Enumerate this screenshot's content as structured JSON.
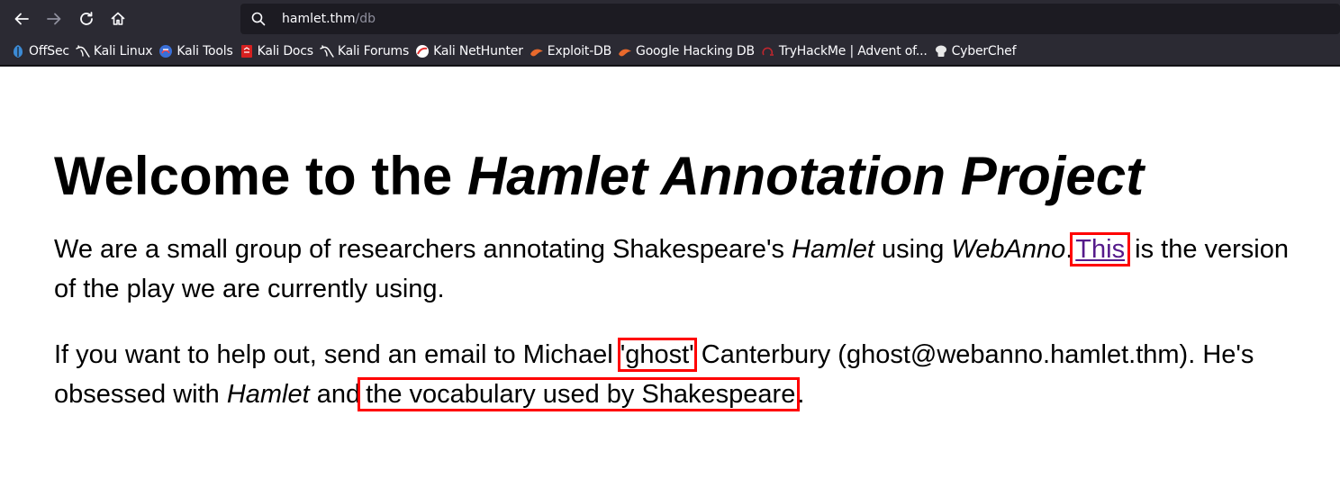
{
  "browser": {
    "url_host": "hamlet.thm",
    "url_path": "/db",
    "bookmarks": [
      {
        "label": "OffSec",
        "icon": "offsec-icon",
        "color": "#3c8bd6"
      },
      {
        "label": "Kali Linux",
        "icon": "kali-dragon-icon",
        "color": "#ffffff"
      },
      {
        "label": "Kali Tools",
        "icon": "kali-tools-icon",
        "color": "#3a6fd8"
      },
      {
        "label": "Kali Docs",
        "icon": "kali-docs-icon",
        "color": "#d62020"
      },
      {
        "label": "Kali Forums",
        "icon": "kali-dragon-icon",
        "color": "#ffffff"
      },
      {
        "label": "Kali NetHunter",
        "icon": "nethunter-icon",
        "color": "#e23030"
      },
      {
        "label": "Exploit-DB",
        "icon": "exploit-db-icon",
        "color": "#e8692c"
      },
      {
        "label": "Google Hacking DB",
        "icon": "ghdb-icon",
        "color": "#e8692c"
      },
      {
        "label": "TryHackMe | Advent of...",
        "icon": "tryhackme-icon",
        "color": "#c0262e"
      },
      {
        "label": "CyberChef",
        "icon": "cyberchef-icon",
        "color": "#e8e8e8"
      }
    ]
  },
  "page": {
    "title_plain": "Welcome to the ",
    "title_em": "Hamlet Annotation Project",
    "p1": {
      "t1": "We are a small group of researchers annotating Shakespeare's ",
      "em1": "Hamlet",
      "t2": " using ",
      "em2": "WebAnno",
      "t3": ".",
      "link": "This",
      "t4": " is the version of the play we are currently using."
    },
    "p2": {
      "t1": "If you want to help out, send an email to Michael ",
      "nick": "'ghost'",
      "t2": " Canterbury (ghost@webanno.hamlet.thm). He's obsessed with ",
      "em1": "Hamlet",
      "t3": " and",
      "vocab": "the vocabulary used by Shakespeare",
      "t4": "."
    },
    "highlight_color": "#ff0000",
    "link_color": "#551a8b"
  }
}
